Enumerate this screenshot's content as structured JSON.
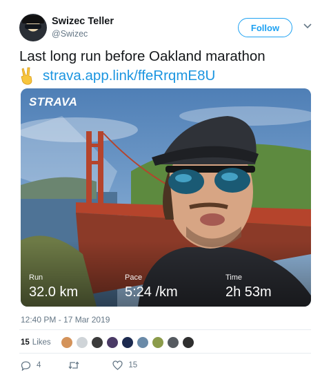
{
  "user": {
    "display_name": "Swizec Teller",
    "handle": "@Swizec",
    "follow_label": "Follow"
  },
  "tweet": {
    "text_line1": "Last long run before Oakland marathon",
    "emoji": "victory-hand",
    "link": "strava.app.link/ffeRrqmE8U",
    "timestamp": "12:40 PM - 17 Mar 2019"
  },
  "media": {
    "brand": "STRAVA",
    "stats": [
      {
        "label": "Run",
        "value": "32.0 km"
      },
      {
        "label": "Pace",
        "value": "5:24 /km"
      },
      {
        "label": "Time",
        "value": "2h 53m"
      }
    ]
  },
  "engagement": {
    "likes_count": "15",
    "likes_label": "Likes",
    "reply_count": "4",
    "retweet_count": "",
    "like_count": "15"
  },
  "colors": {
    "link": "#1b95e0",
    "follow_blue": "#1da1f2",
    "muted": "#657786",
    "bridge": "#b5442c"
  }
}
